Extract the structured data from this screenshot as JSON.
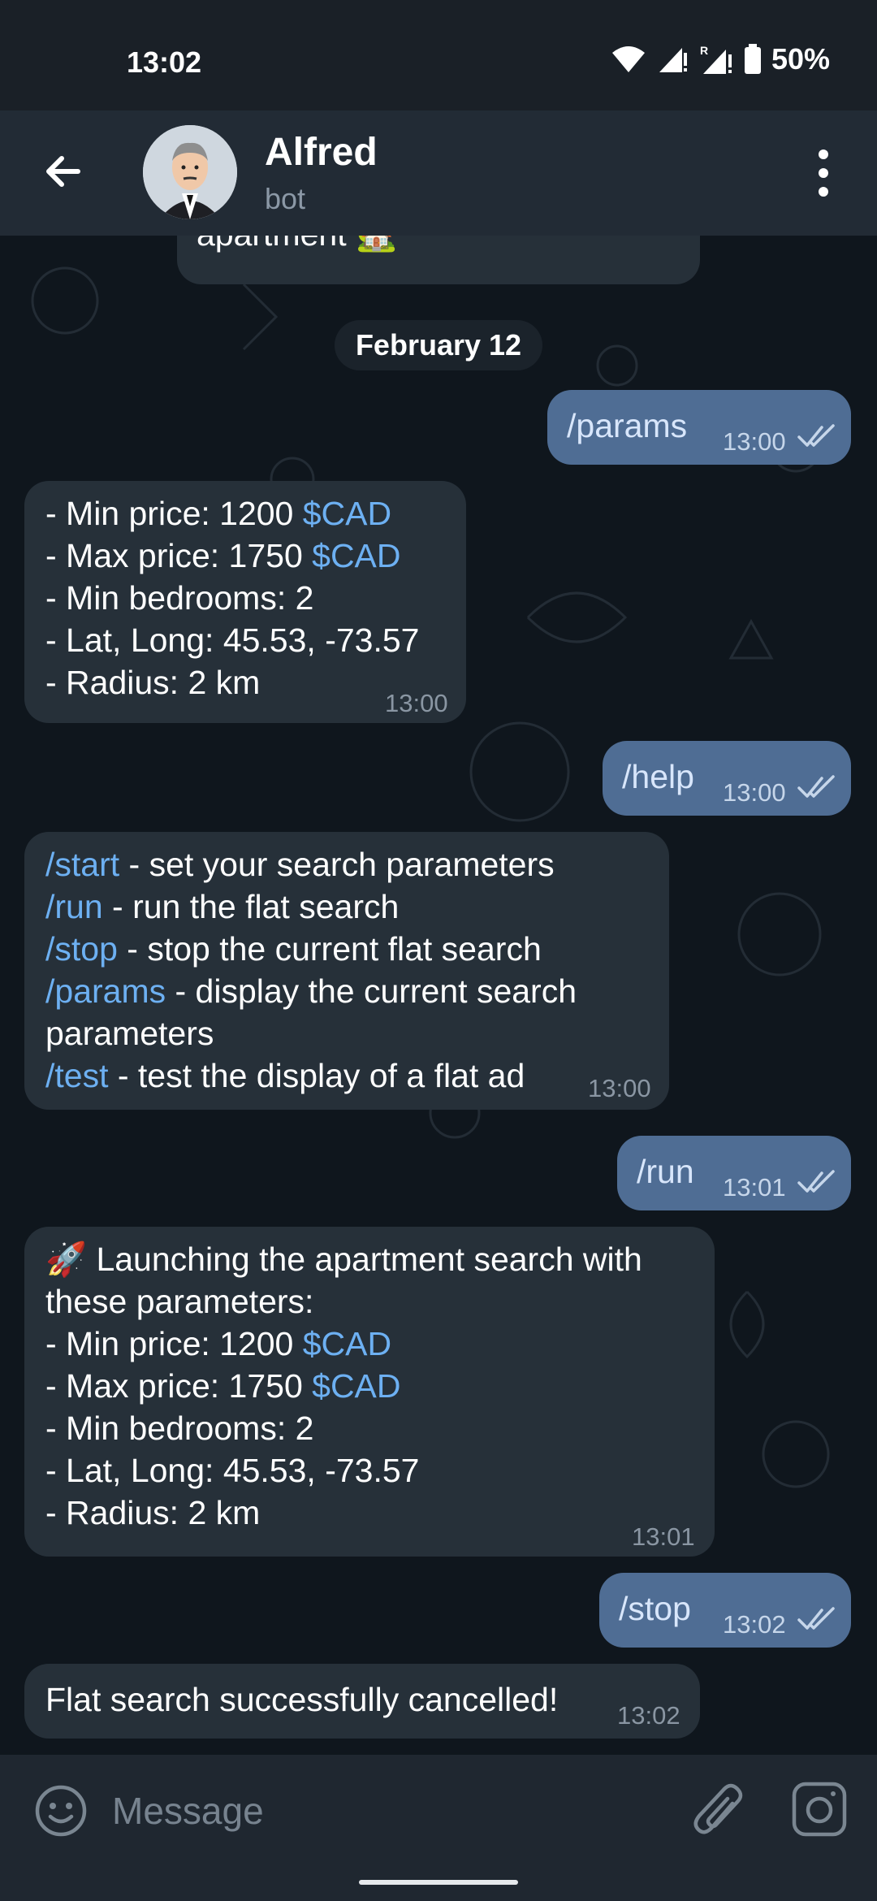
{
  "status": {
    "time": "13:02",
    "battery": "50%"
  },
  "header": {
    "name": "Alfred",
    "subtitle": "bot"
  },
  "date_separator": "February 12",
  "messages": {
    "partial_top": {
      "text": "apartment 🏡"
    },
    "params_cmd": {
      "text": "/params",
      "time": "13:00"
    },
    "params_reply": {
      "lines": [
        {
          "prefix": "- Min price: 1200 ",
          "link": "$CAD"
        },
        {
          "prefix": "- Max price: 1750 ",
          "link": "$CAD"
        },
        {
          "prefix": "- Min bedrooms: 2"
        },
        {
          "prefix": "- Lat, Long: 45.53, -73.57"
        },
        {
          "prefix": "- Radius: 2 km"
        }
      ],
      "time": "13:00"
    },
    "help_cmd": {
      "text": "/help",
      "time": "13:00"
    },
    "help_reply": {
      "lines": [
        {
          "cmd": "/start",
          "desc": " - set your search parameters"
        },
        {
          "cmd": "/run",
          "desc": " - run the flat search"
        },
        {
          "cmd": "/stop",
          "desc": " - stop the current flat search"
        },
        {
          "cmd": "/params",
          "desc": " - display the current search"
        },
        {
          "desc": "parameters"
        },
        {
          "cmd": "/test",
          "desc": " - test the display of a flat ad"
        }
      ],
      "time": "13:00"
    },
    "run_cmd": {
      "text": "/run",
      "time": "13:01"
    },
    "run_reply": {
      "emoji": "🚀",
      "lines": [
        {
          "prefix": " Launching the apartment search with"
        },
        {
          "prefix": "these parameters:"
        },
        {
          "prefix": "- Min price: 1200 ",
          "link": "$CAD"
        },
        {
          "prefix": "- Max price: 1750 ",
          "link": "$CAD"
        },
        {
          "prefix": "- Min bedrooms: 2"
        },
        {
          "prefix": "- Lat, Long: 45.53, -73.57"
        },
        {
          "prefix": "- Radius: 2 km"
        }
      ],
      "time": "13:01"
    },
    "stop_cmd": {
      "text": "/stop",
      "time": "13:02"
    },
    "stop_reply": {
      "text": "Flat search successfully cancelled!",
      "time": "13:02"
    }
  },
  "input": {
    "placeholder": "Message"
  },
  "icons": [
    "back-arrow-icon",
    "more-vert-icon",
    "smile-icon",
    "paperclip-icon",
    "camera-icon",
    "double-check-icon",
    "wifi-icon",
    "signal-icon",
    "battery-icon"
  ],
  "colors": {
    "outgoing": "#4f6d94",
    "incoming": "#263039",
    "link": "#6db0f2",
    "header": "#222b35"
  }
}
